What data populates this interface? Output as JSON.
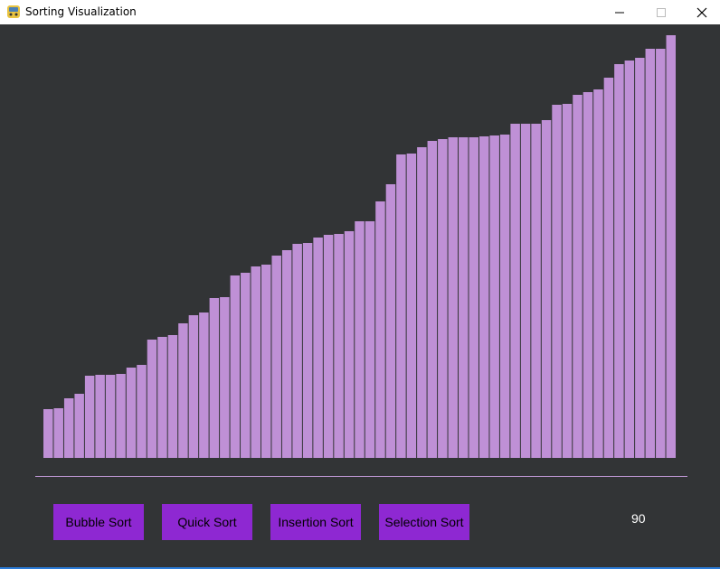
{
  "window": {
    "title": "Sorting Visualization",
    "app_icon": "python-icon"
  },
  "theme": {
    "background": "#323436",
    "bar_color": "#bf90d6",
    "button_color": "#8e28d2"
  },
  "chart_data": {
    "type": "bar",
    "ylim": [
      0,
      470
    ],
    "values": [
      54,
      55,
      66,
      71,
      91,
      92,
      92,
      93,
      100,
      103,
      131,
      134,
      136,
      149,
      158,
      161,
      177,
      178,
      202,
      205,
      212,
      214,
      224,
      230,
      237,
      238,
      244,
      247,
      248,
      251,
      262,
      262,
      284,
      303,
      336,
      337,
      344,
      351,
      353,
      355,
      355,
      355,
      356,
      357,
      358,
      370,
      370,
      370,
      374,
      391,
      392,
      402,
      405,
      408,
      421,
      436,
      440,
      443,
      453,
      453,
      468
    ]
  },
  "controls": {
    "buttons": [
      "Bubble Sort",
      "Quick Sort",
      "Insertion Sort",
      "Selection Sort"
    ],
    "count_value": "90"
  }
}
